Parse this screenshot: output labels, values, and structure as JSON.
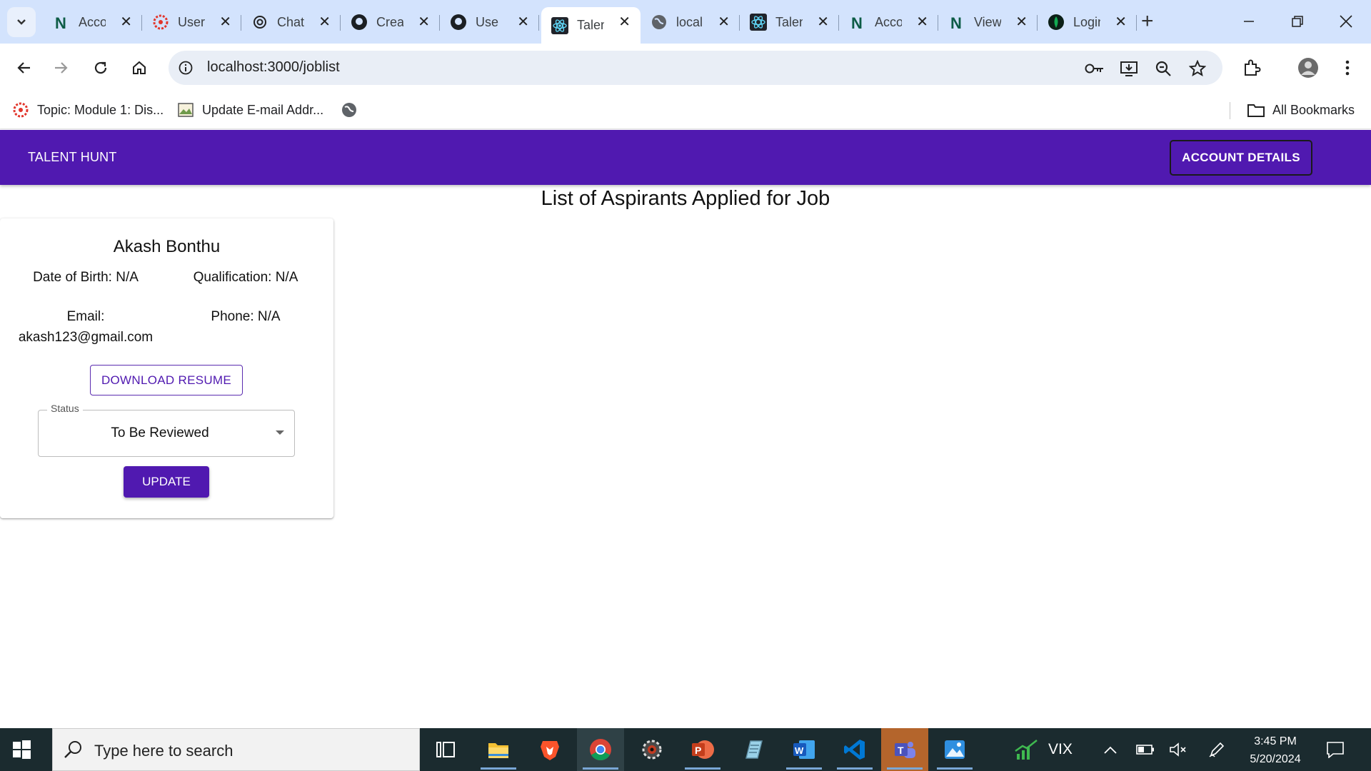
{
  "browser": {
    "tabs": [
      {
        "label": "Account",
        "icon": "notion-n-icon"
      },
      {
        "label": "Users",
        "icon": "canvas-icon"
      },
      {
        "label": "ChatGPT",
        "icon": "openai-icon"
      },
      {
        "label": "Create",
        "icon": "github-icon"
      },
      {
        "label": "Use",
        "icon": "github-icon"
      },
      {
        "label": "Talent Hunt",
        "icon": "react-icon",
        "active": true
      },
      {
        "label": "localhost",
        "icon": "globe-icon"
      },
      {
        "label": "Talent Hunt",
        "icon": "react-icon"
      },
      {
        "label": "Account",
        "icon": "notion-n-icon"
      },
      {
        "label": "View",
        "icon": "notion-n-icon"
      },
      {
        "label": "Login",
        "icon": "mongodb-leaf-icon"
      }
    ],
    "url": "localhost:3000/joblist",
    "bookmarks": [
      {
        "label": "Topic: Module 1: Dis...",
        "icon": "canvas-icon"
      },
      {
        "label": "Update E-mail Addr...",
        "icon": "image-icon"
      },
      {
        "label": "",
        "icon": "globe-icon"
      }
    ],
    "all_bookmarks_label": "All Bookmarks"
  },
  "app": {
    "brand": "TALENT HUNT",
    "account_button": "ACCOUNT DETAILS",
    "page_title": "List of Aspirants Applied for Job",
    "accent_color": "#5019b0"
  },
  "candidate": {
    "name": "Akash Bonthu",
    "dob": "Date of Birth: N/A",
    "qualification": "Qualification: N/A",
    "email_label": "Email:",
    "email": "akash123@gmail.com",
    "phone": "Phone: N/A",
    "download_button": "DOWNLOAD RESUME",
    "status_label": "Status",
    "status_value": "To Be Reviewed",
    "update_button": "UPDATE"
  },
  "taskbar": {
    "search_placeholder": "Type here to search",
    "apps": [
      "task-view",
      "file-explorer",
      "brave",
      "chrome",
      "settings",
      "powerpoint",
      "notepad",
      "word",
      "vscode",
      "teams",
      "photos"
    ],
    "ticker": "VIX",
    "time": "3:45 PM",
    "date": "5/20/2024"
  }
}
